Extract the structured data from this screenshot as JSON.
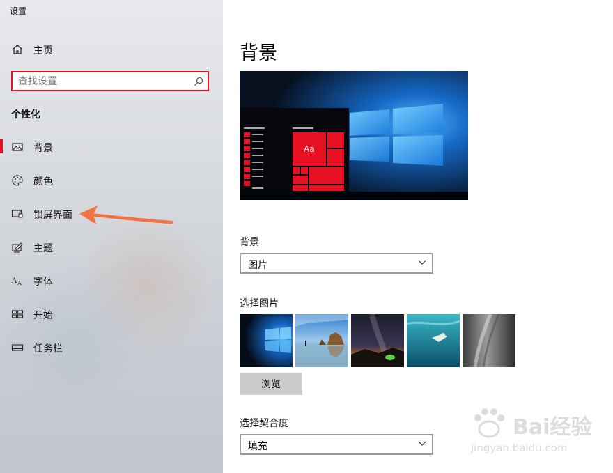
{
  "window": {
    "title": "设置"
  },
  "sidebar": {
    "home_label": "主页",
    "search_placeholder": "查找设置",
    "section_title": "个性化",
    "items": [
      {
        "label": "背景",
        "icon": "image-icon",
        "active": true
      },
      {
        "label": "颜色",
        "icon": "palette-icon",
        "active": false
      },
      {
        "label": "锁屏界面",
        "icon": "lock-screen-icon",
        "active": false
      },
      {
        "label": "主题",
        "icon": "theme-brush-icon",
        "active": false
      },
      {
        "label": "字体",
        "icon": "font-icon",
        "active": false
      },
      {
        "label": "开始",
        "icon": "start-tiles-icon",
        "active": false
      },
      {
        "label": "任务栏",
        "icon": "taskbar-icon",
        "active": false
      }
    ]
  },
  "main": {
    "title": "背景",
    "preview": {
      "tile_text": "Aa"
    },
    "background_label": "背景",
    "background_value": "图片",
    "choose_picture_label": "选择图片",
    "browse_label": "浏览",
    "fit_label": "选择契合度",
    "fit_value": "填充"
  },
  "watermark": {
    "text": "Bai经验",
    "sub": "jingyan.baidu.com"
  },
  "colors": {
    "accent": "#e81123",
    "arrow": "#f07440"
  }
}
